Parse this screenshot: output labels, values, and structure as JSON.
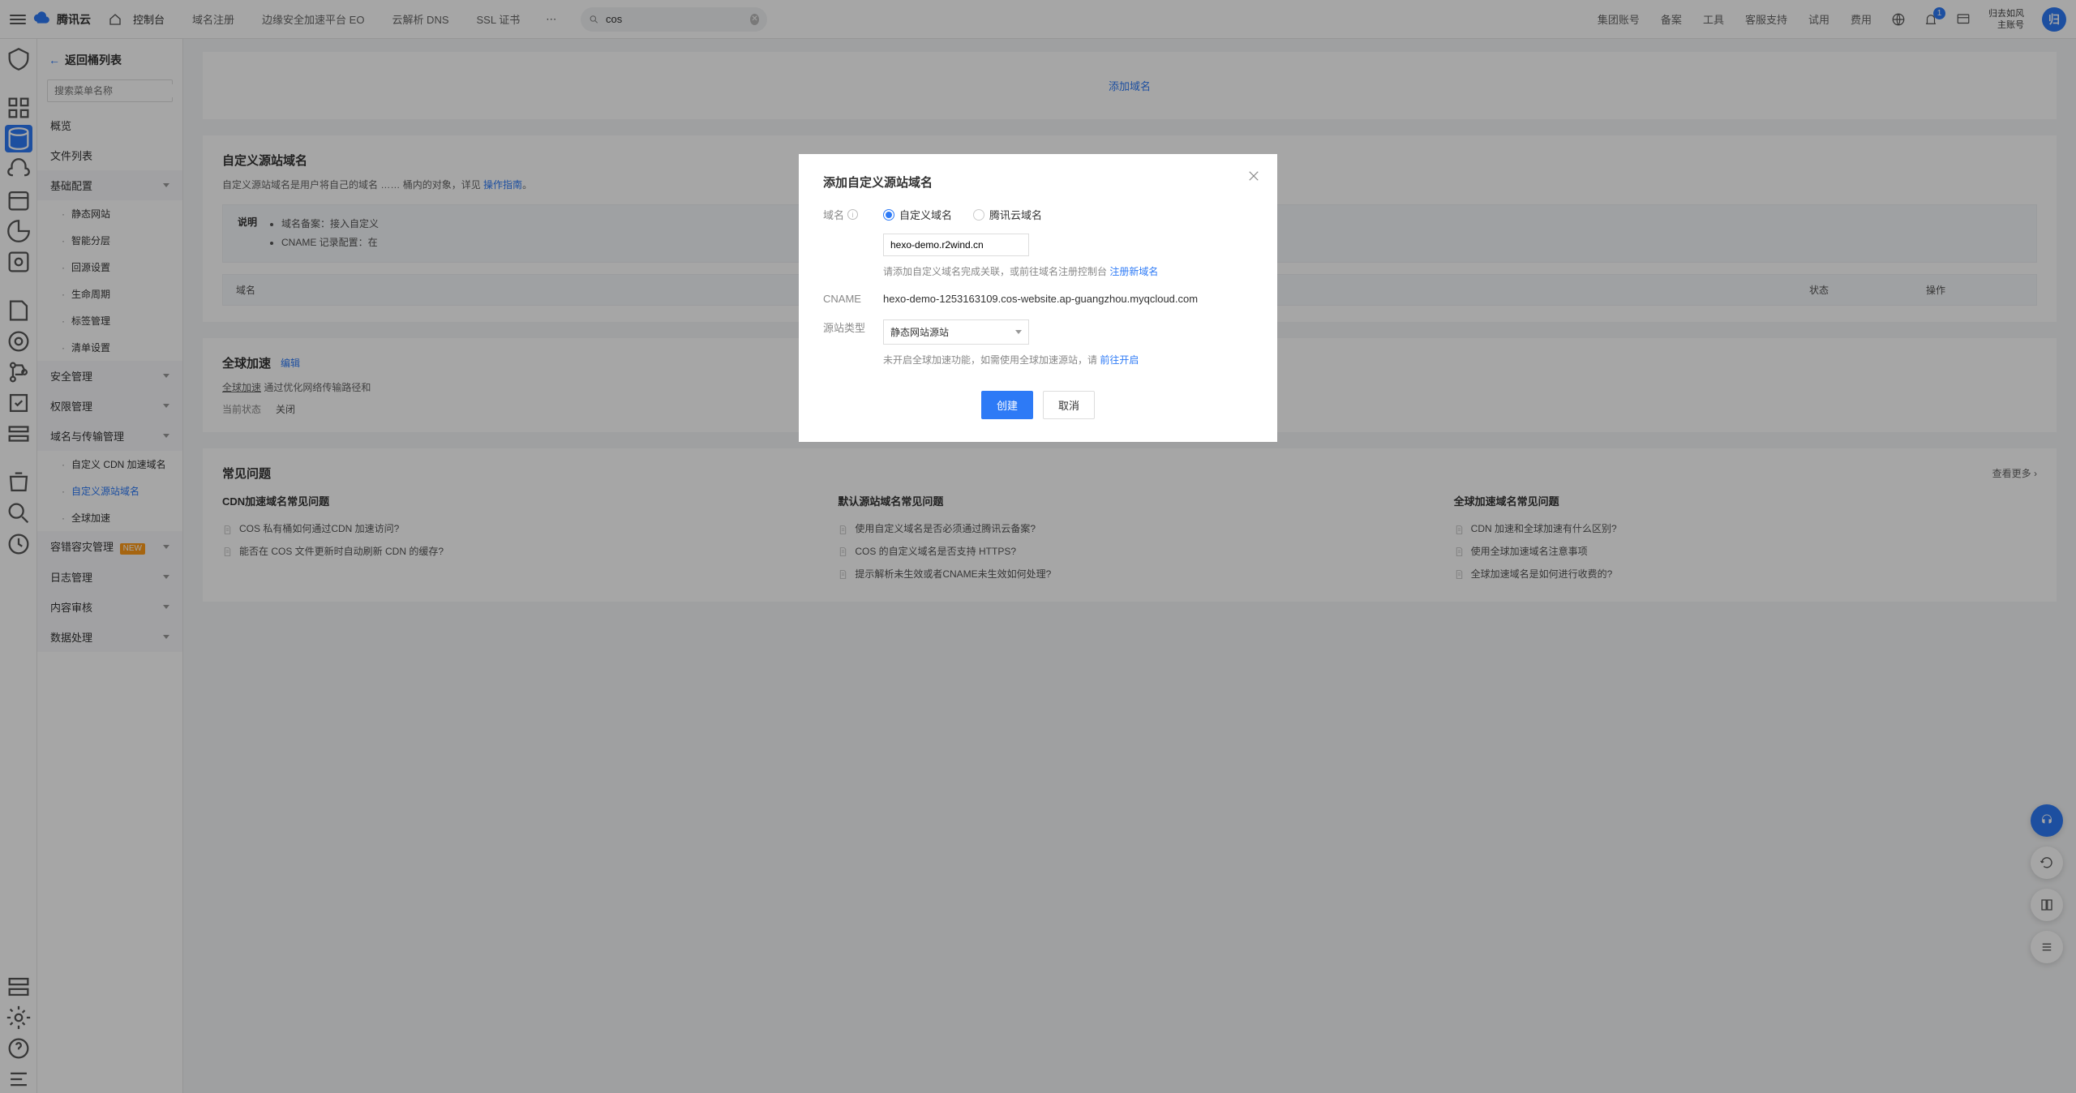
{
  "top": {
    "brand": "腾讯云",
    "console": "控制台",
    "nav": [
      "域名注册",
      "边缘安全加速平台 EO",
      "云解析 DNS",
      "SSL 证书"
    ],
    "search_value": "cos",
    "right": [
      "集团账号",
      "备案",
      "工具",
      "客服支持",
      "试用",
      "费用"
    ],
    "notif_count": "1",
    "account_name": "归去如风",
    "account_role": "主账号",
    "avatar_initial": "归"
  },
  "sidepanel": {
    "back": "返回桶列表",
    "search_placeholder": "搜索菜单名称",
    "items_top": [
      "概览",
      "文件列表"
    ],
    "group_basic": "基础配置",
    "basic_children": [
      "静态网站",
      "智能分层",
      "回源设置",
      "生命周期",
      "标签管理",
      "清单设置"
    ],
    "group_security": "安全管理",
    "group_permission": "权限管理",
    "group_domain": "域名与传输管理",
    "domain_children": [
      "自定义 CDN 加速域名",
      "自定义源站域名",
      "全球加速"
    ],
    "group_fault": "容错容灾管理",
    "group_log": "日志管理",
    "group_audit": "内容审核",
    "group_data": "数据处理",
    "new_tag": "NEW"
  },
  "page": {
    "add_domain_link": "添加域名",
    "custom_origin": {
      "title": "自定义源站域名",
      "desc_prefix": "自定义源站域名是用户将自己的域名",
      "desc_suffix": "桶内的对象，详见 ",
      "desc_link": "操作指南",
      "desc_period": "。"
    },
    "note": {
      "label": "说明",
      "items": [
        "域名备案：接入自定义",
        "CNAME 记录配置：在"
      ]
    },
    "table": {
      "h1": "域名",
      "h2": "状态",
      "h3": "操作"
    },
    "global": {
      "title": "全球加速",
      "edit": "编辑",
      "desc_key": "全球加速",
      "desc": "通过优化网络传输路径和",
      "status_k": "当前状态",
      "status_v": "关闭"
    },
    "faq": {
      "title": "常见问题",
      "more": "查看更多",
      "cols": [
        {
          "title": "CDN加速域名常见问题",
          "items": [
            "COS 私有桶如何通过CDN 加速访问?",
            "能否在 COS 文件更新时自动刷新 CDN 的缓存?"
          ]
        },
        {
          "title": "默认源站域名常见问题",
          "items": [
            "使用自定义域名是否必须通过腾讯云备案?",
            "COS 的自定义域名是否支持 HTTPS?",
            "提示解析未生效或者CNAME未生效如何处理?"
          ]
        },
        {
          "title": "全球加速域名常见问题",
          "items": [
            "CDN 加速和全球加速有什么区别?",
            "使用全球加速域名注意事项",
            "全球加速域名是如何进行收费的?"
          ]
        }
      ]
    }
  },
  "modal": {
    "title": "添加自定义源站域名",
    "label_domain": "域名",
    "radio_custom": "自定义域名",
    "radio_tc": "腾讯云域名",
    "domain_value": "hexo-demo.r2wind.cn",
    "hint1": "请添加自定义域名完成关联，或前往域名注册控制台 ",
    "hint1_link": "注册新域名",
    "label_cname": "CNAME",
    "cname_value": "hexo-demo-1253163109.cos-website.ap-guangzhou.myqcloud.com",
    "label_origin_type": "源站类型",
    "origin_type_value": "静态网站源站",
    "hint2": "未开启全球加速功能，如需使用全球加速源站，请 ",
    "hint2_link": "前往开启",
    "btn_create": "创建",
    "btn_cancel": "取消"
  }
}
